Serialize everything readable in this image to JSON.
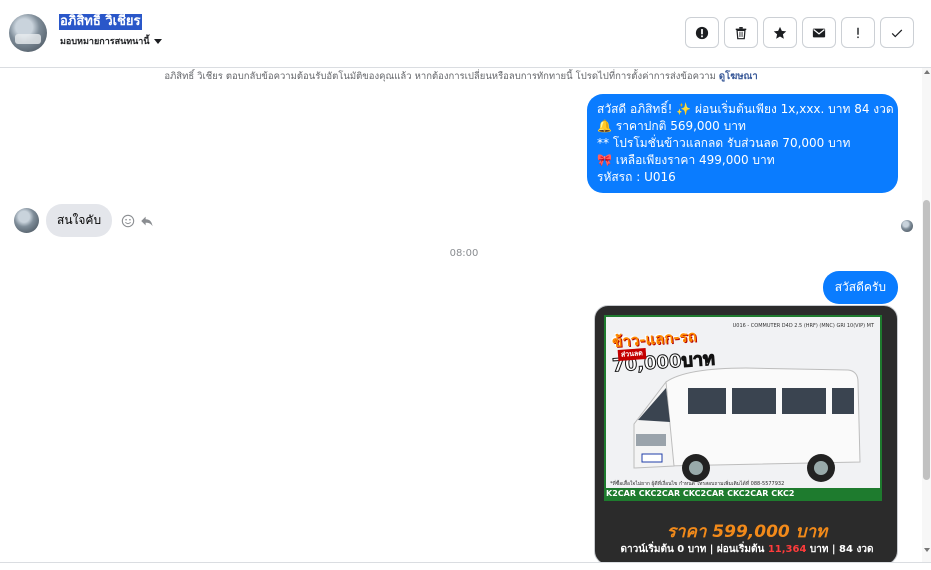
{
  "header": {
    "contact_name": "อภิสิทธิ์ วิเชียร",
    "assign_label": "มอบหมายการสนทนานี้"
  },
  "system_note": {
    "text": "อภิสิทธิ์ วิเชียร ตอบกลับข้อความต้อนรับอัตโนมัติของคุณแล้ว หากต้องการเปลี่ยนหรือลบการทักทายนี้ โปรดไปที่การตั้งค่าการส่งข้อความ",
    "link": "ดูโฆษณา"
  },
  "messages": {
    "promo_lines": [
      "สวัสดี อภิสิทธิ์! ✨  ผ่อนเริ่มต้นเพียง 1x,xxx. บาท 84 งวด",
      "🔔 ราคาปกติ 569,000 บาท",
      "** โปรโมชั่นข้าวแลกลด รับส่วนลด 70,000 บาท",
      "🎀  เหลือเพียงราคา 499,000 บาท",
      " รหัสรถ : U016"
    ],
    "incoming": "สนใจคับ",
    "timestamp": "08:00",
    "hello": "สวัสดีครับ"
  },
  "card": {
    "photo_caption": "U016 - COMMUTER D4D 2.5 (HRF) (MNC) GRI 10(VIP) MT",
    "promo_title": "ข้าว-แลก-รถ",
    "promo_sub": "ส่วนลด",
    "promo_amount": "70,000บาท",
    "photo_tag": "*ที่ซื้อเสื้อใจไม่ยาก ผู้ดีที่เงื่อนไข กำหนด โทรสอบถามเพิ่มเติมได้ที่ 088-5577932",
    "banner": "K2CAR CKC2CAR CKC2CAR CKC2CAR CKC2",
    "price": "ราคา 599,000 บาท",
    "terms_prefix": "ดาวน์เริ่มต้น 0 บาท | ผ่อนเริ่มต้น",
    "terms_hl": "11,364",
    "terms_suffix": "บาท | 84 งวด"
  },
  "colors": {
    "accent": "#0a7cff",
    "incoming_bg": "#e4e6eb",
    "name_highlight": "#2a57c9"
  },
  "icons": [
    "alert-icon",
    "trash-icon",
    "star-icon",
    "mail-icon",
    "exclamation-icon",
    "check-icon",
    "smiley-icon",
    "reply-icon",
    "caret-down-icon"
  ]
}
